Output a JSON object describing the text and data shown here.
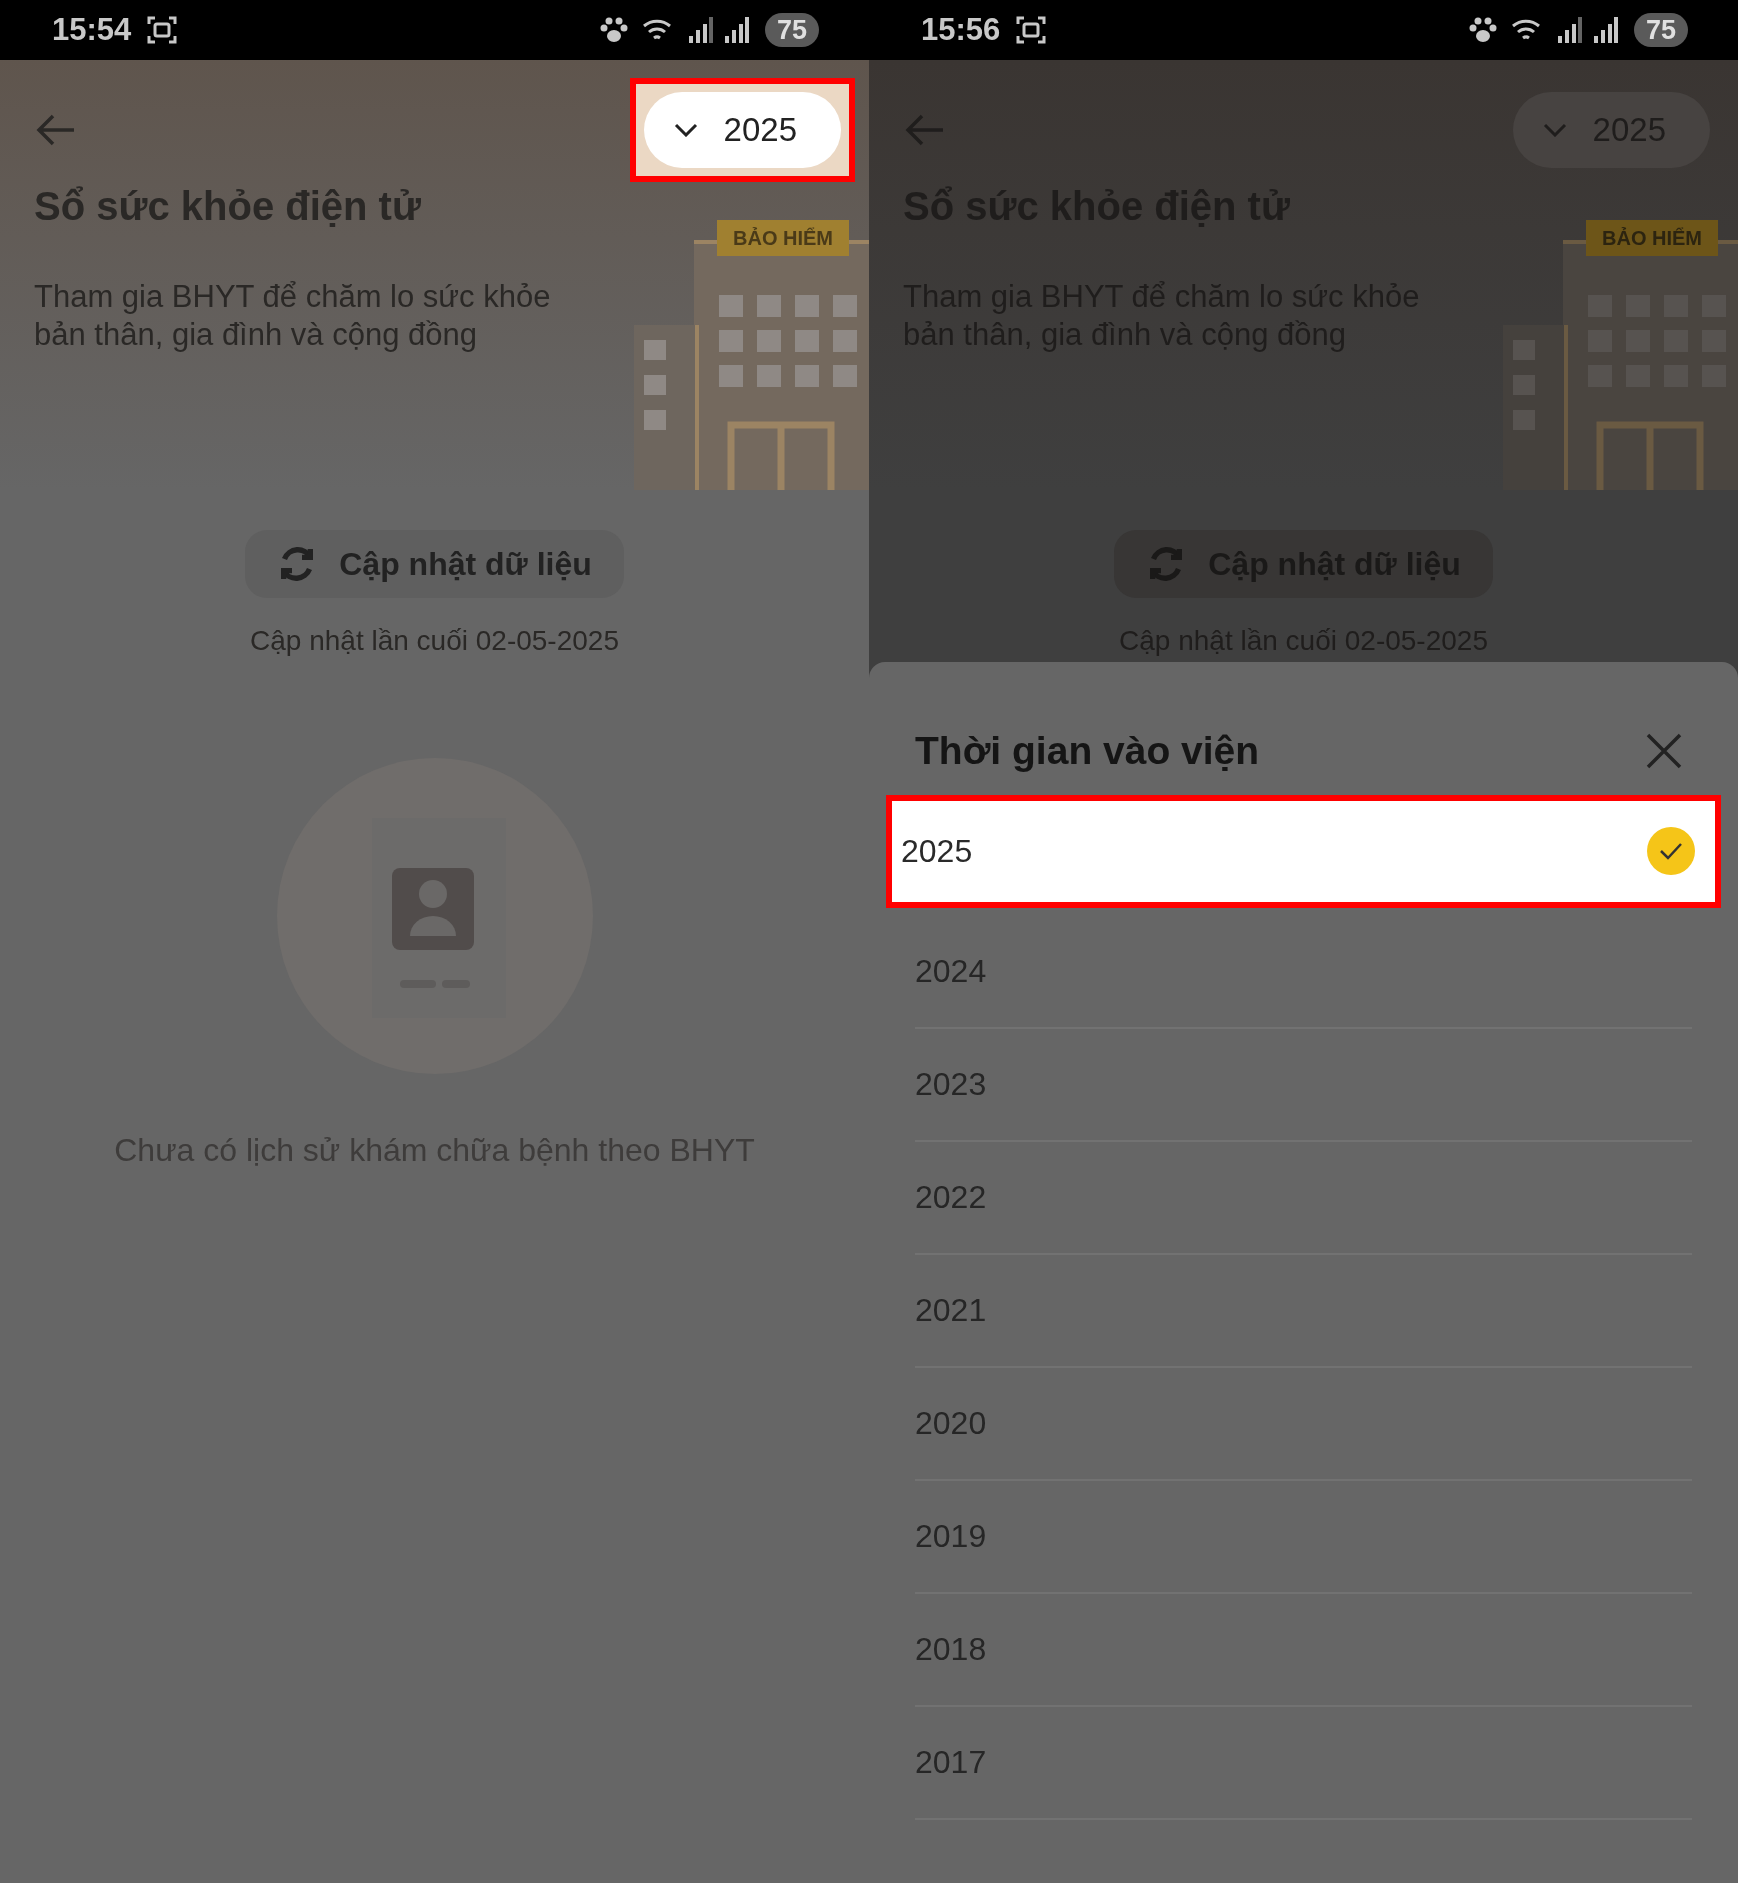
{
  "screens": [
    {
      "status_bar": {
        "time": "15:54",
        "battery": "75"
      },
      "year_picker": {
        "value": "2025",
        "highlighted": true
      },
      "title": "Sổ sức khỏe điện tử",
      "description": "Tham gia BHYT để chăm lo sức khỏe bản thân, gia đình và cộng đồng",
      "illustration_sign": "BẢO HIỂM",
      "refresh_button": "Cập nhật dữ liệu",
      "last_updated": "Cập nhật lần cuối 02-05-2025",
      "empty_state": "Chưa có lịch sử khám chữa bệnh theo BHYT"
    },
    {
      "status_bar": {
        "time": "15:56",
        "battery": "75"
      },
      "year_picker": {
        "value": "2025",
        "highlighted": false
      },
      "title": "Sổ sức khỏe điện tử",
      "description": "Tham gia BHYT để chăm lo sức khỏe bản thân, gia đình và cộng đồng",
      "illustration_sign": "BẢO HIỂM",
      "refresh_button": "Cập nhật dữ liệu",
      "last_updated": "Cập nhật lần cuối 02-05-2025",
      "sheet": {
        "title": "Thời gian vào viện",
        "options": [
          {
            "label": "2025",
            "selected": true
          },
          {
            "label": "2024",
            "selected": false
          },
          {
            "label": "2023",
            "selected": false
          },
          {
            "label": "2022",
            "selected": false
          },
          {
            "label": "2021",
            "selected": false
          },
          {
            "label": "2020",
            "selected": false
          },
          {
            "label": "2019",
            "selected": false
          },
          {
            "label": "2018",
            "selected": false
          },
          {
            "label": "2017",
            "selected": false
          }
        ]
      }
    }
  ]
}
